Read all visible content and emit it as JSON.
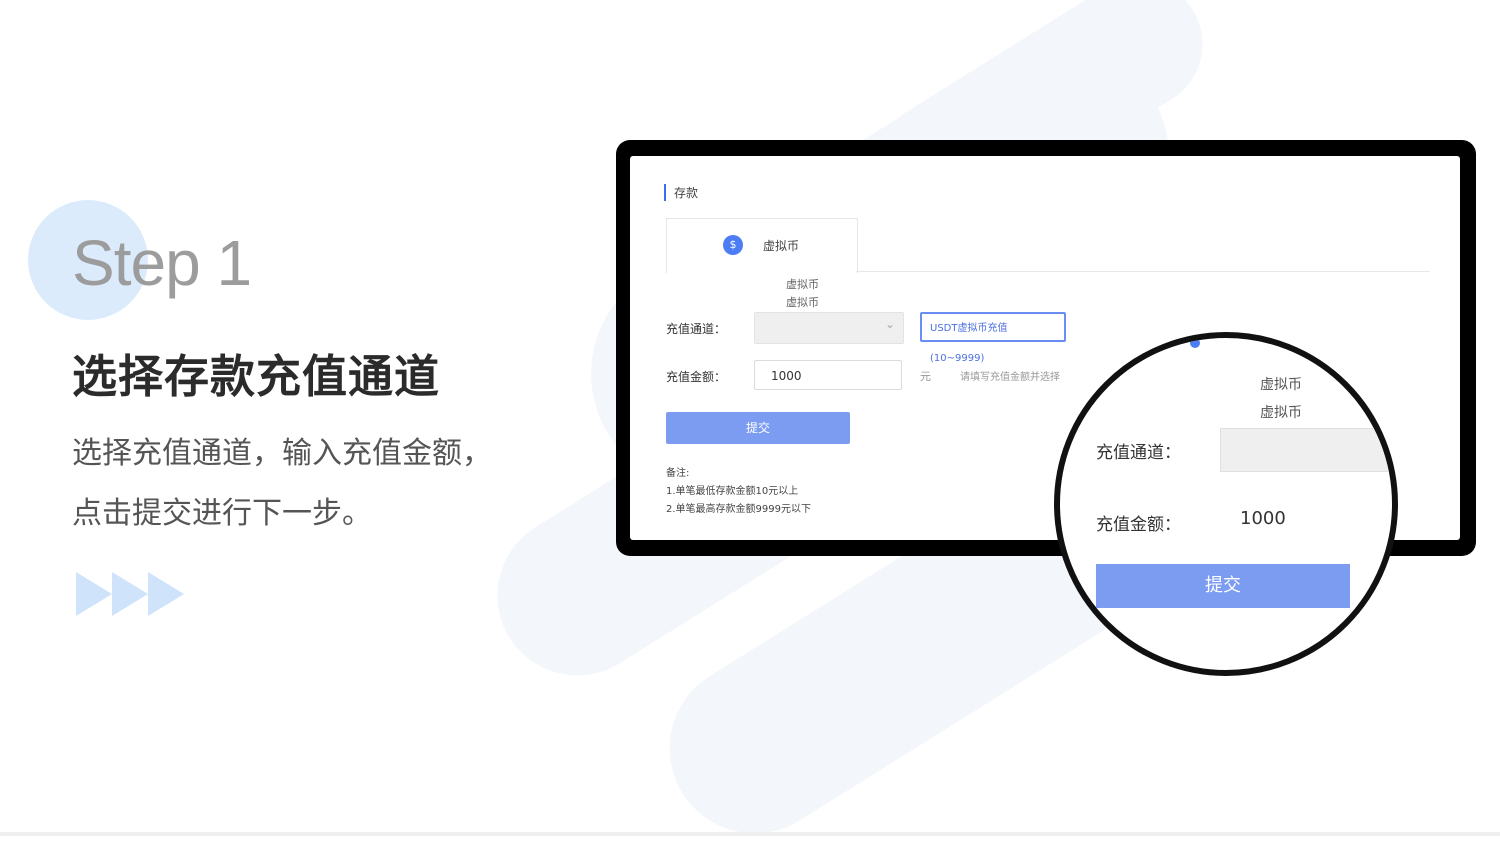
{
  "step": {
    "title": "Step 1",
    "headline": "选择存款充值通道",
    "description_line1": "选择充值通道，输入充值金额，",
    "description_line2": "点击提交进行下一步。"
  },
  "screen": {
    "title": "存款",
    "tab": {
      "badge": "$",
      "label": "虚拟币"
    },
    "channel_options": [
      "虚拟币",
      "虚拟币"
    ],
    "channel_label": "充值通道：",
    "channel_selected": "USDT虚拟币充值 (10~9999)",
    "amount_label": "充值金额：",
    "amount_value": "1000",
    "amount_unit": "元",
    "amount_hint": "请填写充值金额并选择",
    "submit_label": "提交",
    "notes_title": "备注:",
    "notes": [
      "1.单笔最低存款金额10元以上",
      "2.单笔最高存款金额9999元以下"
    ]
  },
  "magnifier": {
    "options": [
      "虚拟币",
      "虚拟币"
    ],
    "channel_label": "充值通道：",
    "amount_label": "充值金额：",
    "amount_value": "1000",
    "submit_label": "提交"
  },
  "colors": {
    "accent": "#7c9cf1",
    "step_circle": "#dcebfb",
    "arrow": "#cfe3fb",
    "frame": "#000000"
  }
}
